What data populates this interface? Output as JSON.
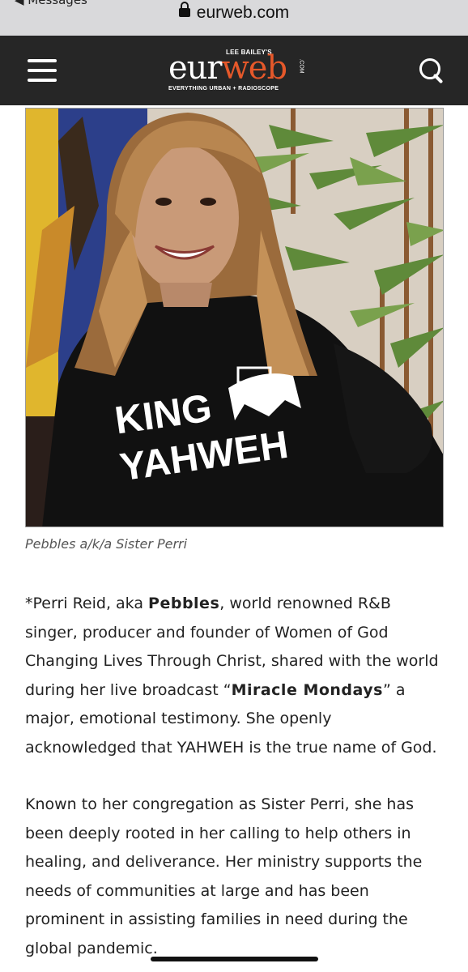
{
  "browser": {
    "back_app_label": "◀ Messages",
    "url": "eurweb.com"
  },
  "site": {
    "logo": {
      "top_tagline": "LEE BAILEY'S",
      "name_part1": "eur",
      "name_part2": "web",
      "com": ".COM",
      "bottom_tagline": "EVERYTHING URBAN + RADIOSCOPE"
    },
    "accent_color": "#e5582a",
    "header_bg": "#262626"
  },
  "photo": {
    "shirt_text_line1": "KING",
    "shirt_text_line2": "YAHWEH"
  },
  "caption": "Pebbles a/k/a Sister Perri",
  "article": {
    "p1": {
      "t1": "*Perri Reid, aka ",
      "b1": "Pebbles",
      "t2": ", world renowned R&B singer, producer and founder of Women of God Changing Lives Through Christ, shared with the world during her live broadcast “",
      "b2": "Miracle Mondays",
      "t3": "” a major, emotional testimony. She openly acknowledged that YAHWEH is the true name of God."
    },
    "p2": "Known to her congregation as Sister Perri, she has been deeply rooted in her calling to help others in healing, and deliverance. Her ministry supports the needs of communities at large and has been prominent in assisting families in need during the global pandemic."
  }
}
